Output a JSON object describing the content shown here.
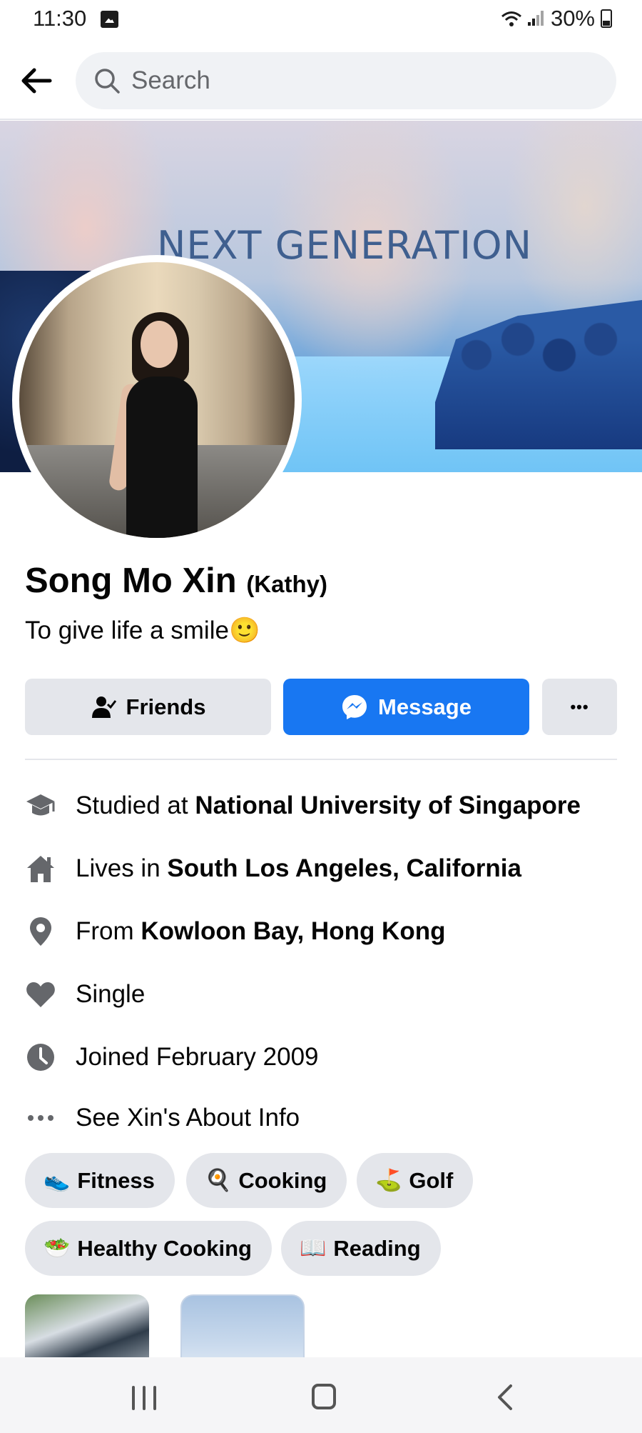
{
  "status_bar": {
    "time": "11:30",
    "battery": "30%"
  },
  "search": {
    "placeholder": "Search"
  },
  "cover": {
    "title": "NEXT GENERATION"
  },
  "profile": {
    "name": "Song Mo Xin",
    "nickname": "(Kathy)",
    "bio": "To give life a smile🙂"
  },
  "actions": {
    "friends": "Friends",
    "message": "Message",
    "more": "•••"
  },
  "details": [
    {
      "icon": "graduation-cap-icon",
      "prefix": "Studied at ",
      "value": "National University of Singapore"
    },
    {
      "icon": "home-icon",
      "prefix": "Lives in ",
      "value": "South Los Angeles, California"
    },
    {
      "icon": "location-pin-icon",
      "prefix": "From ",
      "value": "Kowloon Bay, Hong Kong"
    },
    {
      "icon": "heart-icon",
      "prefix": "",
      "value": "Single"
    },
    {
      "icon": "clock-icon",
      "prefix": "",
      "value": "Joined February 2009"
    },
    {
      "icon": "more-dots-icon",
      "prefix": "",
      "value": "See Xin's About Info"
    }
  ],
  "interests": [
    {
      "emoji": "👟",
      "label": "Fitness"
    },
    {
      "emoji": "🍳",
      "label": "Cooking"
    },
    {
      "emoji": "⛳",
      "label": "Golf"
    },
    {
      "emoji": "🥗",
      "label": "Healthy Cooking"
    },
    {
      "emoji": "📖",
      "label": "Reading"
    }
  ],
  "colors": {
    "accent": "#1877f2",
    "button_gray": "#e4e6eb",
    "text": "#050505",
    "secondary_text": "#65676b"
  }
}
